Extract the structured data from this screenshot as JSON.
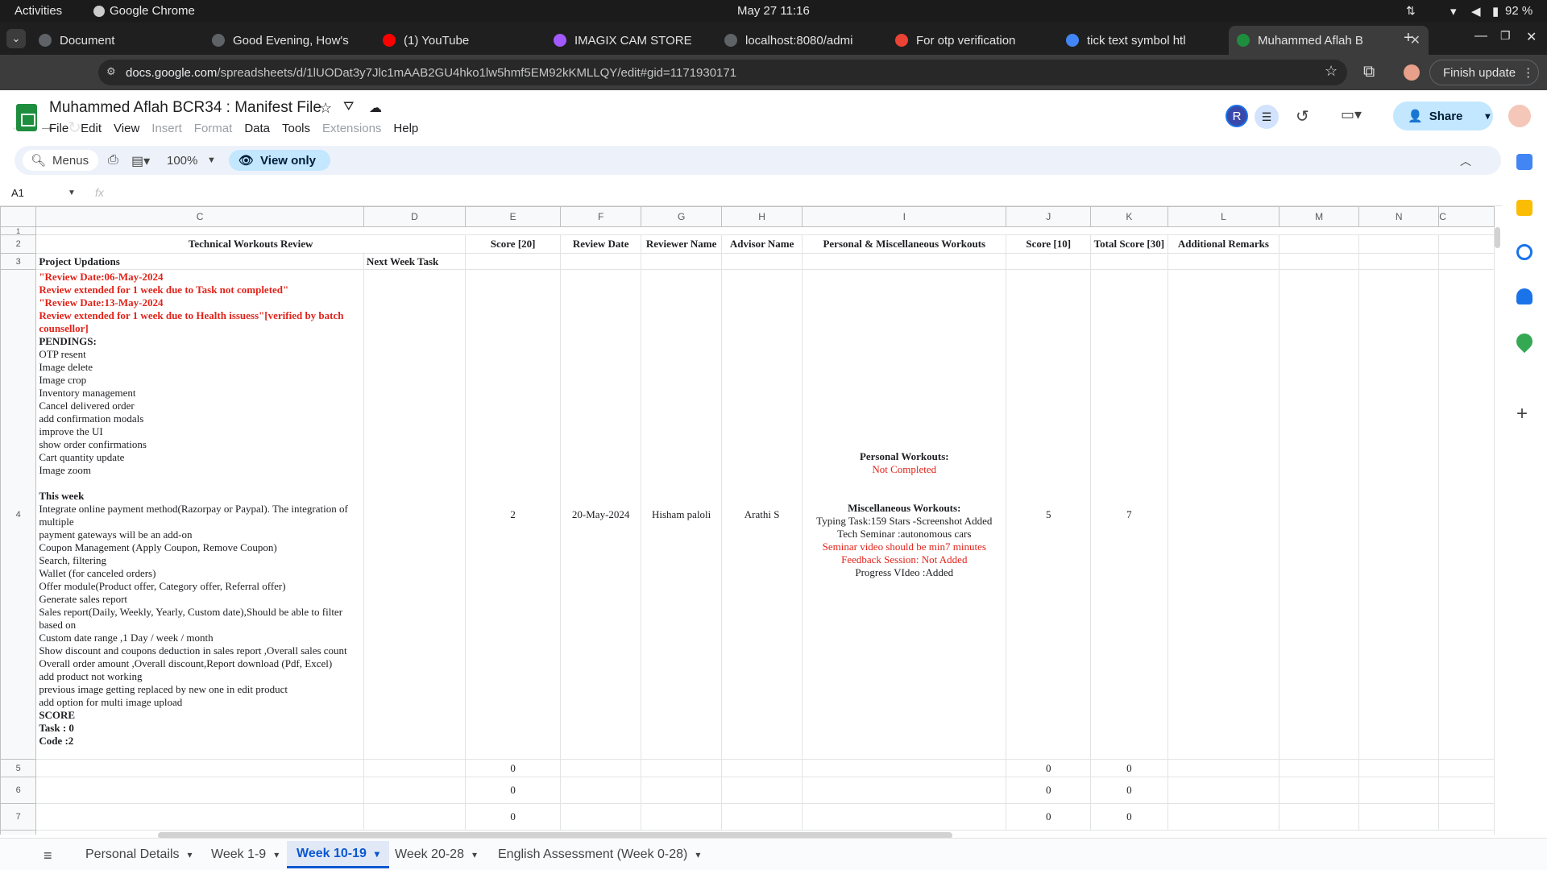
{
  "system": {
    "activities": "Activities",
    "browser": "Google Chrome",
    "datetime": "May 27  11:16",
    "battery": "92 %"
  },
  "tabs": [
    {
      "label": "Document",
      "color": "#5f6368",
      "active": false
    },
    {
      "label": "Good Evening, How's",
      "color": "#5f6368",
      "active": false
    },
    {
      "label": "(1) YouTube",
      "color": "#ff0000",
      "active": false
    },
    {
      "label": "IMAGIX CAM STORE",
      "color": "#a259ff",
      "active": false
    },
    {
      "label": "localhost:8080/admi",
      "color": "#5f6368",
      "active": false
    },
    {
      "label": "For otp verification",
      "color": "#ea4335",
      "active": false
    },
    {
      "label": "tick text symbol htl",
      "color": "#4285f4",
      "active": false
    },
    {
      "label": "Muhammed Aflah B",
      "color": "#1e8e3e",
      "active": true
    }
  ],
  "address": {
    "domain": "docs.google.com",
    "path": "/spreadsheets/d/1lUODat3y7Jlc1mAAB2GU4hko1lw5hmf5EM92kKMLLQY/edit#gid=1171930171",
    "finish_update": "Finish update"
  },
  "doc": {
    "title": "Muhammed Aflah BCR34 : Manifest File",
    "menus": [
      "File",
      "Edit",
      "View",
      "Insert",
      "Format",
      "Data",
      "Tools",
      "Extensions",
      "Help"
    ],
    "disabled_menus": [
      "Insert",
      "Format",
      "Extensions"
    ],
    "share": "Share",
    "avatar_letter": "R"
  },
  "toolbar": {
    "menus": "Menus",
    "zoom": "100%",
    "view_only": "View only"
  },
  "formula": {
    "cell": "A1",
    "fx": "fx"
  },
  "columns": [
    "C",
    "D",
    "E",
    "F",
    "G",
    "H",
    "I",
    "J",
    "K",
    "L",
    "M",
    "N",
    "C"
  ],
  "header_row": {
    "c": "Technical Workouts Review",
    "e": "Score [20]",
    "f": "Review Date",
    "g": "Reviewer Name",
    "h": "Advisor Name",
    "i": "Personal & Miscellaneous Workouts",
    "j": "Score [10]",
    "k": "Total Score [30]",
    "l": "Additional Remarks"
  },
  "row3": {
    "c": "Project Updations",
    "d": "Next Week Task"
  },
  "row4": {
    "c_lines": [
      {
        "t": "\"Review Date:06-May-2024",
        "s": "red bold"
      },
      {
        "t": "Review extended  for 1 week  due to Task not completed\"",
        "s": "red bold"
      },
      {
        "t": "\"Review Date:13-May-2024",
        "s": "red bold"
      },
      {
        "t": "Review extended for 1 week due to Health issuess\"[verified by batch",
        "s": "red bold"
      },
      {
        "t": "counsellor]",
        "s": "red bold"
      },
      {
        "t": "PENDINGS:",
        "s": "bold"
      },
      {
        "t": "OTP resent",
        "s": ""
      },
      {
        "t": "Image delete",
        "s": ""
      },
      {
        "t": "Image crop",
        "s": ""
      },
      {
        "t": "Inventory management",
        "s": ""
      },
      {
        "t": "Cancel delivered order",
        "s": ""
      },
      {
        "t": "add confirmation modals",
        "s": ""
      },
      {
        "t": "improve the UI",
        "s": ""
      },
      {
        "t": "show order confirmations",
        "s": ""
      },
      {
        "t": "Cart quantity update",
        "s": ""
      },
      {
        "t": "Image zoom",
        "s": ""
      },
      {
        "t": "",
        "s": ""
      },
      {
        "t": "This week",
        "s": "bold"
      },
      {
        "t": "Integrate online payment method(Razorpay or Paypal). The integration of",
        "s": ""
      },
      {
        "t": "multiple",
        "s": ""
      },
      {
        "t": "payment gateways will be an add-on",
        "s": ""
      },
      {
        "t": "Coupon Management (Apply Coupon, Remove Coupon)",
        "s": ""
      },
      {
        "t": "Search, filtering",
        "s": ""
      },
      {
        "t": "Wallet (for canceled orders)",
        "s": ""
      },
      {
        "t": "Offer module(Product offer, Category offer, Referral offer)",
        "s": ""
      },
      {
        "t": "Generate sales report",
        "s": ""
      },
      {
        "t": "Sales report(Daily, Weekly, Yearly, Custom date),Should be able to filter",
        "s": ""
      },
      {
        "t": "based on",
        "s": ""
      },
      {
        "t": "Custom date range ,1 Day / week / month",
        "s": ""
      },
      {
        "t": "Show  discount and coupons deduction in sales report ,Overall sales count",
        "s": ""
      },
      {
        "t": "Overall order amount ,Overall discount,Report download (Pdf, Excel)",
        "s": ""
      },
      {
        "t": "add product not working",
        "s": ""
      },
      {
        "t": "previous image getting replaced by new one in edit product",
        "s": ""
      },
      {
        "t": "add option for multi image upload",
        "s": ""
      },
      {
        "t": "SCORE",
        "s": "bold"
      },
      {
        "t": "Task : 0",
        "s": "bold"
      },
      {
        "t": "Code :2",
        "s": "bold"
      }
    ],
    "e": "2",
    "f": "20-May-2024",
    "g": "Hisham paloli",
    "h": "Arathi S",
    "i_lines": [
      {
        "t": "Personal Workouts:",
        "s": "bold"
      },
      {
        "t": "Not Completed",
        "s": "red"
      },
      {
        "t": "",
        "s": ""
      },
      {
        "t": "",
        "s": ""
      },
      {
        "t": "Miscellaneous Workouts:",
        "s": "bold"
      },
      {
        "t": "Typing Task:159 Stars -Screenshot Added",
        "s": ""
      },
      {
        "t": "Tech Seminar :autonomous cars",
        "s": ""
      },
      {
        "t": "Seminar video should be min7 minutes",
        "s": "red"
      },
      {
        "t": "Feedback Session: Not Added",
        "s": "red"
      },
      {
        "t": "Progress VIdeo :Added",
        "s": ""
      }
    ],
    "j": "5",
    "k": "7"
  },
  "empty_rows": [
    {
      "n": "5",
      "e": "0",
      "j": "0",
      "k": "0"
    },
    {
      "n": "6",
      "e": "0",
      "j": "0",
      "k": "0"
    },
    {
      "n": "7",
      "e": "0",
      "j": "0",
      "k": "0"
    }
  ],
  "sheet_tabs": [
    "Personal Details",
    "Week 1-9",
    "Week 10-19",
    "Week 20-28",
    "English Assessment (Week 0-28)"
  ],
  "active_sheet": "Week 10-19"
}
